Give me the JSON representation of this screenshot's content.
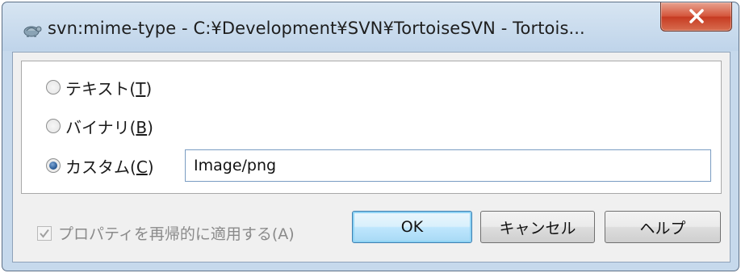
{
  "window": {
    "title": "svn:mime-type - C:¥Development¥SVN¥TortoiseSVN - Tortois...",
    "close_label": "✕"
  },
  "options": {
    "text_label": "テキスト(",
    "text_mnemonic": "T",
    "binary_label": "バイナリ(",
    "binary_mnemonic": "B",
    "custom_label": "カスタム(",
    "custom_mnemonic": "C",
    "close_paren": ")",
    "selected": "custom"
  },
  "custom_input": {
    "value": "Image/png"
  },
  "recursive": {
    "label": "プロパティを再帰的に適用する(A)",
    "checked": true,
    "enabled": false
  },
  "buttons": {
    "ok": "OK",
    "cancel": "キャンセル",
    "help": "ヘルプ"
  },
  "colors": {
    "titlebar": "#c6d9ec",
    "close_button": "#c63b22",
    "client_background": "#f0f0f0",
    "default_button_border": "#3c7fb1"
  },
  "icons": {
    "app": "tortoise-icon",
    "close": "close-icon",
    "check": "check-icon"
  }
}
